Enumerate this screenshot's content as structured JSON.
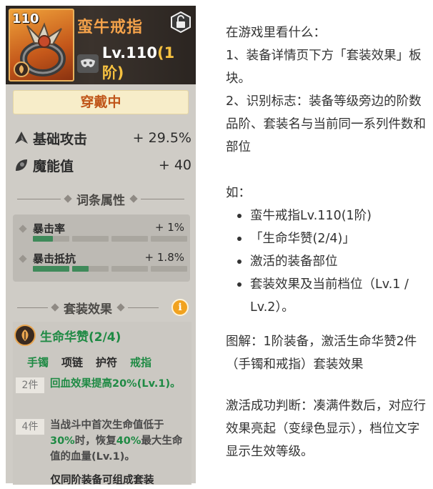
{
  "item": {
    "level_corner": "110",
    "name": "蛮牛戒指",
    "level_text": "Lv.110",
    "tier_text": "(1阶)",
    "equipped_label": "穿戴中",
    "icons": {
      "lock": "lock-open-icon",
      "mask": "mask-icon",
      "tier": "leaf-emblem-icon"
    }
  },
  "base_stats": [
    {
      "name": "基础攻击",
      "value": "+ 29.5%",
      "icon": "attack-icon"
    },
    {
      "name": "魔能值",
      "value": "+ 40",
      "icon": "magic-icon"
    }
  ],
  "affix_section": {
    "title": "词条属性",
    "affixes": [
      {
        "name": "暴击率",
        "value": "+ 1%",
        "fills": [
          0.55,
          0,
          0,
          0
        ]
      },
      {
        "name": "暴击抵抗",
        "value": "+ 1.8%",
        "fills": [
          1,
          0.45,
          0,
          0
        ]
      }
    ]
  },
  "set_section": {
    "title": "套装效果",
    "info_icon": "i",
    "set_name": "生命华赞(2/4)",
    "parts": [
      {
        "label": "手镯",
        "active": true
      },
      {
        "label": "项链",
        "active": false
      },
      {
        "label": "护符",
        "active": false
      },
      {
        "label": "戒指",
        "active": true
      }
    ],
    "tiers": [
      {
        "tag": "2件",
        "text": "回血效果提高20%(Lv.1)。",
        "active": true
      },
      {
        "tag": "4件",
        "text_parts": [
          "当战斗中首次生命值低于",
          "30%",
          "时，恢复",
          "40%",
          "最大生命值的血量(Lv.1)。"
        ],
        "active": false
      }
    ],
    "footer": "仅同阶装备可组成套装"
  },
  "article": {
    "intro": "在游戏里看什么：",
    "point1": "1、装备详情页下方「套装效果」板块。",
    "point2": "2、识别标志：装备等级旁边的阶数品阶、套装名与当前同一系列件数和部位",
    "example_label": "如：",
    "bullets": [
      "蛮牛戒指Lv.110(1阶)",
      "「生命华赞(2/4)」",
      "激活的装备部位",
      "套装效果及当前档位（Lv.1 / Lv.2）。"
    ],
    "caption": "图解：1阶装备，激活生命华赞2件（手镯和戒指）套装效果",
    "conclusion": "激活成功判断：凑满件数后，对应行效果亮起（变绿色显示），档位文字显示生效等级。"
  },
  "colors": {
    "name_orange": "#f4a24a",
    "tier_gold": "#f6c140",
    "active_green": "#1f8a44",
    "equipped_bg": "#f7edc9"
  }
}
